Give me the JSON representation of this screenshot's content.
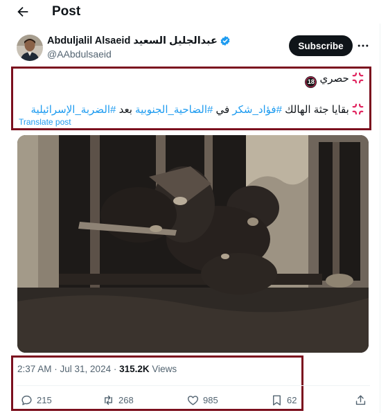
{
  "header": {
    "title": "Post"
  },
  "author": {
    "name": "Abduljalil Alsaeid عبدالجليل السعيد",
    "handle": "@AAbdulsaeid"
  },
  "subscribe_label": "Subscribe",
  "tweet": {
    "line1_text": "حصري",
    "line2_prefix": "بقايا جثة الهالك",
    "hashtag1": "#فؤاد_شكر",
    "word_in": "في",
    "hashtag2": "#الضاحية_الجنوبية",
    "word_after": "بعد",
    "hashtag3": "#الضربة_الإسرائيلية",
    "translate": "Translate post",
    "badge": "18"
  },
  "meta": {
    "time_date": "2:37 AM · Jul 31, 2024 · ",
    "views_count": "315.2K",
    "views_label": " Views"
  },
  "actions": {
    "replies": "215",
    "reposts": "268",
    "likes": "985",
    "bookmarks": "62"
  },
  "icons": [
    "back-arrow-icon",
    "verified-badge-icon",
    "more-icon",
    "anger-symbol-emoji",
    "reply-icon",
    "repost-icon",
    "like-icon",
    "bookmark-icon",
    "share-icon"
  ],
  "colors": {
    "accent": "#1d9bf0",
    "highlight_box": "#7b0f1e",
    "muted": "#536471"
  }
}
